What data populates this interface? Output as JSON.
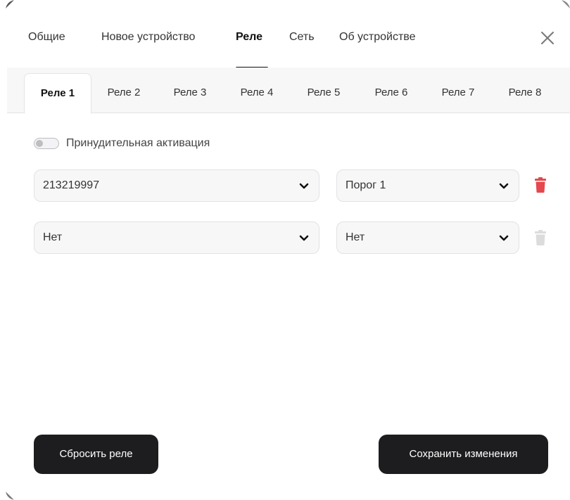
{
  "nav": {
    "tabs": [
      {
        "label": "Общие"
      },
      {
        "label": "Новое устройство"
      },
      {
        "label": "Реле"
      },
      {
        "label": "Сеть"
      },
      {
        "label": "Об устройстве"
      }
    ],
    "active": "Реле"
  },
  "relay_tabs": [
    "Реле 1",
    "Реле 2",
    "Реле 3",
    "Реле 4",
    "Реле 5",
    "Реле 6",
    "Реле 7",
    "Реле 8"
  ],
  "relay_tab_active": "Реле 1",
  "force_activation": {
    "label": "Принудительная активация",
    "enabled": false
  },
  "rules": [
    {
      "device": "213219997",
      "threshold": "Порог 1",
      "delete_enabled": true
    },
    {
      "device": "Нет",
      "threshold": "Нет",
      "delete_enabled": false
    }
  ],
  "buttons": {
    "reset": "Сбросить реле",
    "save": "Сохранить изменения"
  },
  "colors": {
    "delete_active": "#e5484d",
    "delete_disabled": "#dcdcde",
    "button_bg": "#1d1d20"
  }
}
